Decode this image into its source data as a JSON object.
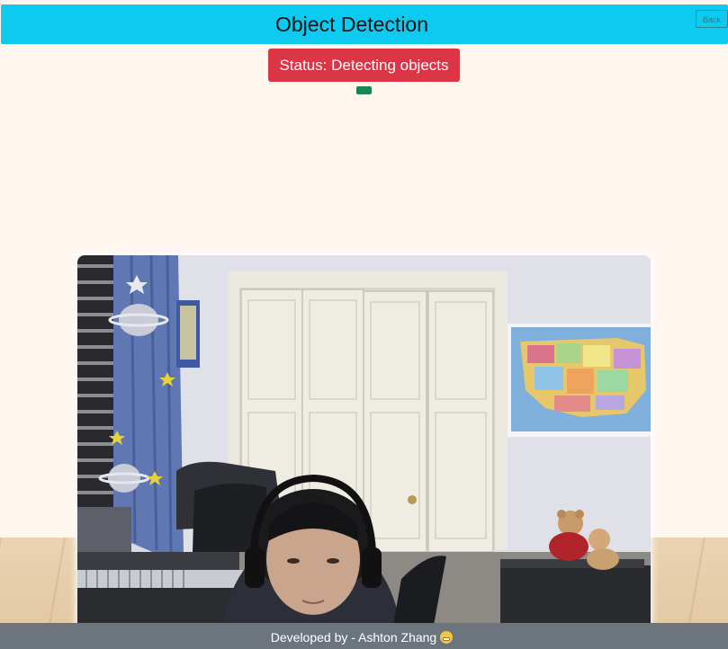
{
  "header": {
    "title": "Object Detection",
    "back_label": "Back"
  },
  "status": {
    "label": "Status: Detecting objects",
    "color": "#dc3545"
  },
  "indicator": {
    "color": "#198754"
  },
  "webcam": {
    "icon": "webcam-feed"
  },
  "footer": {
    "text": "Developed by - Ashton Zhang",
    "emoji_icon": "grinning-face-icon"
  },
  "colors": {
    "header": "#0dcaf0",
    "page_background": "#fff6f0",
    "footer": "#6c757d"
  }
}
